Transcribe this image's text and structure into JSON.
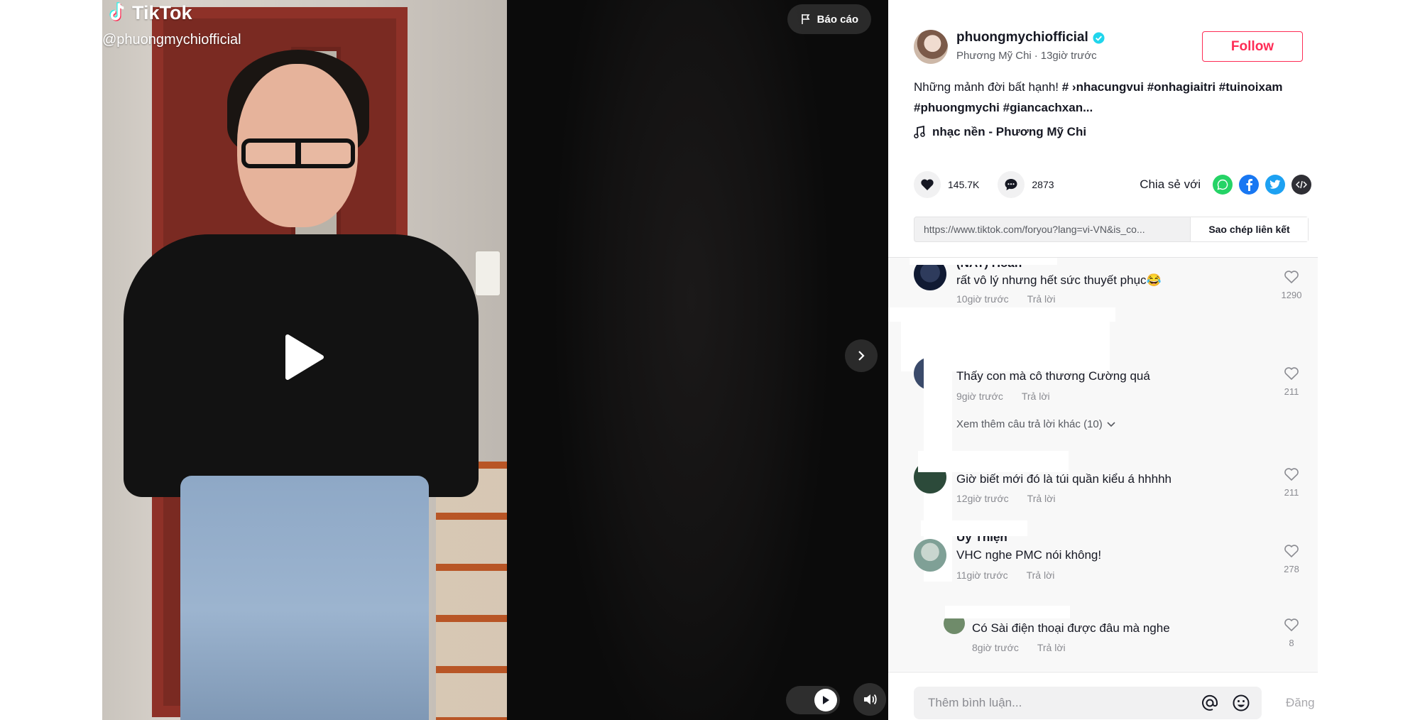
{
  "video": {
    "logo_text": "TikTok",
    "handle": "@phuongmychiofficial",
    "report_label": "Báo cáo",
    "icons": [
      "tiktok-logo-icon",
      "play-icon",
      "flag-icon",
      "chevron-right-icon",
      "volume-icon"
    ]
  },
  "author": {
    "username": "phuongmychiofficial",
    "display_name": "Phương Mỹ Chi",
    "separator": "·",
    "time_ago": "13giờ trước",
    "verified": true,
    "follow_label": "Follow"
  },
  "caption": {
    "text": "Những mảnh đời bất hạnh!",
    "tags_line1": [
      "# ›nhacungvui",
      "#onhagiaitri",
      "#tuinoixam"
    ],
    "tags_line2": [
      "#phuongmychi",
      "#giancachxan..."
    ]
  },
  "music": {
    "label": "nhạc nền - Phương Mỹ Chi",
    "icon": "music-note-icon"
  },
  "stats": {
    "likes": "145.7K",
    "comments": "2873",
    "share_label": "Chia sẻ với"
  },
  "share": {
    "whatsapp_color": "#25d366",
    "facebook_color": "#1877f2",
    "twitter_color": "#1da1f2",
    "embed_color": "#2f2f35"
  },
  "link": {
    "url": "https://www.tiktok.com/foryou?lang=vi-VN&is_co...",
    "copy_label": "Sao chép liên kết"
  },
  "comments": [
    {
      "name": "(NAT) Hoàn",
      "text": "rất vô lý nhưng hết sức thuyết phục😂",
      "time": "10giờ trước",
      "reply": "Trả lời",
      "likes": "1290"
    },
    {
      "name": "",
      "text": "Thấy con mà cô thương Cường quá",
      "time": "9giờ trước",
      "reply": "Trả lời",
      "likes": "211",
      "more": "Xem thêm câu trả lời khác (10)"
    },
    {
      "name": "",
      "text": "Giờ biết mới đó là túi quần kiểu á hhhhh",
      "time": "12giờ trước",
      "reply": "Trả lời",
      "likes": "211"
    },
    {
      "name": "Uy Thiện",
      "text": "VHC nghe PMC nói không!",
      "time": "11giờ trước",
      "reply": "Trả lời",
      "likes": "278"
    },
    {
      "name": "",
      "text": "Có Sài điện thoại được đâu mà nghe",
      "time": "8giờ trước",
      "reply": "Trả lời",
      "likes": "8"
    }
  ],
  "comment_bar": {
    "placeholder": "Thêm bình luận...",
    "post_label": "Đăng"
  },
  "colors": {
    "accent": "#fe2c55",
    "verified": "#20d5ec"
  }
}
